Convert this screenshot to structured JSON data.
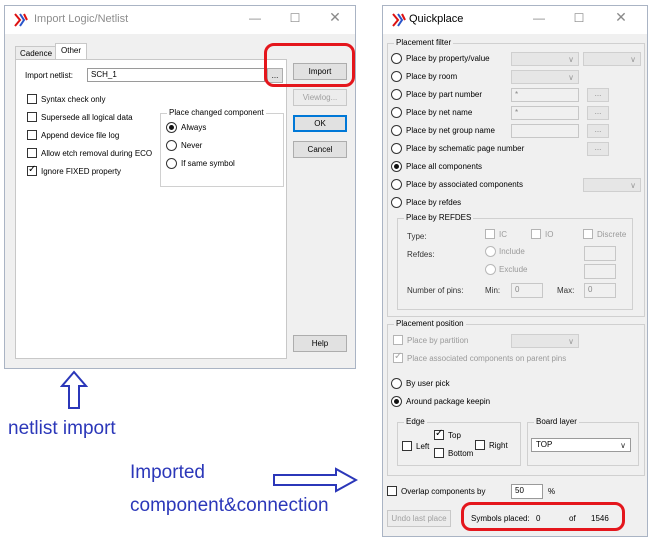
{
  "import_dialog": {
    "title": "Import Logic/Netlist",
    "tabs": [
      "Cadence",
      "Other"
    ],
    "import_netlist_label": "Import netlist:",
    "netlist_value": "SCH_1",
    "browse_label": "...",
    "checkboxes": [
      {
        "label": "Syntax check only",
        "checked": false
      },
      {
        "label": "Supersede all logical data",
        "checked": false
      },
      {
        "label": "Append device file log",
        "checked": false
      },
      {
        "label": "Allow etch removal during ECO",
        "checked": false
      },
      {
        "label": "Ignore FIXED property",
        "checked": true
      }
    ],
    "place_changed_title": "Place changed component",
    "place_changed_options": [
      {
        "label": "Always",
        "selected": true
      },
      {
        "label": "Never",
        "selected": false
      },
      {
        "label": "If same symbol",
        "selected": false
      }
    ],
    "buttons": {
      "import": "Import",
      "viewlog": "Viewlog...",
      "ok": "OK",
      "cancel": "Cancel",
      "help": "Help"
    }
  },
  "quickplace": {
    "title": "Quickplace",
    "placement_filter_title": "Placement filter",
    "filter_options": [
      {
        "label": "Place by property/value",
        "selected": false
      },
      {
        "label": "Place by room",
        "selected": false
      },
      {
        "label": "Place by part number",
        "selected": false
      },
      {
        "label": "Place by net name",
        "selected": false
      },
      {
        "label": "Place by net group name",
        "selected": false
      },
      {
        "label": "Place by schematic page number",
        "selected": false
      },
      {
        "label": "Place all components",
        "selected": true
      },
      {
        "label": "Place by associated components",
        "selected": false
      },
      {
        "label": "Place by refdes",
        "selected": false
      }
    ],
    "part_number_value": "*",
    "net_name_value": "*",
    "dots_label": "...",
    "refdes_group": {
      "title": "Place by REFDES",
      "type_label": "Type:",
      "types": [
        "IC",
        "IO",
        "Discrete"
      ],
      "refdes_label": "Refdes:",
      "include_label": "Include",
      "exclude_label": "Exclude",
      "num_pins_label": "Number of pins:",
      "min_label": "Min:",
      "min_value": "0",
      "max_label": "Max:",
      "max_value": "0"
    },
    "placement_position_title": "Placement position",
    "place_by_partition": "Place by partition",
    "place_associated": "Place associated components on parent pins",
    "by_user_pick": "By user pick",
    "around_package": "Around package keepin",
    "edge_title": "Edge",
    "edge_left": "Left",
    "edge_top": "Top",
    "edge_right": "Right",
    "edge_bottom": "Bottom",
    "board_layer_title": "Board layer",
    "board_layer_value": "TOP",
    "overlap_label": "Overlap components by",
    "overlap_value": "50",
    "percent": "%",
    "undo_label": "Undo last place",
    "symbols_placed_label": "Symbols placed:",
    "symbols_placed_value": "0",
    "of_label": "of",
    "total_value": "1546"
  },
  "annotations": {
    "netlist_import": "netlist import",
    "imported_line1": "Imported",
    "imported_line2": "component&connection"
  },
  "colors": {
    "annotation": "#2b37b9",
    "highlight": "#e4161c"
  }
}
